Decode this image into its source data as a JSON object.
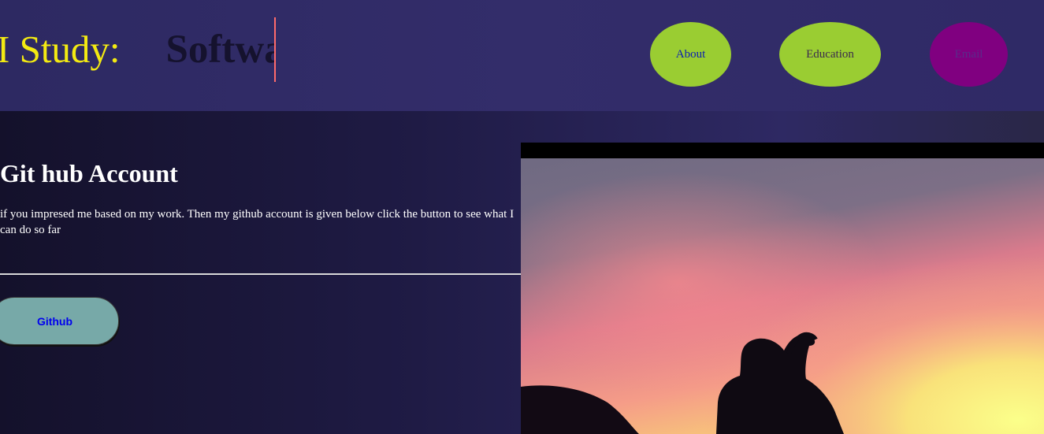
{
  "header": {
    "prefix": "I Study:",
    "typed_text": "Software"
  },
  "nav": {
    "about_label": "About",
    "education_label": "Education",
    "third_label": "Email"
  },
  "section": {
    "title": "Git hub Account",
    "description": "if you impresed me based on my work. Then my github account is given below click the button to see what I can do so far",
    "button_label": "Github"
  },
  "colors": {
    "header_bg": "#2f2a66",
    "headline_prefix": "#f3ea12",
    "nav_green": "#9acd32",
    "nav_purple": "#800080",
    "button_bg": "#77a9a8",
    "caret": "#ff6b6b"
  }
}
